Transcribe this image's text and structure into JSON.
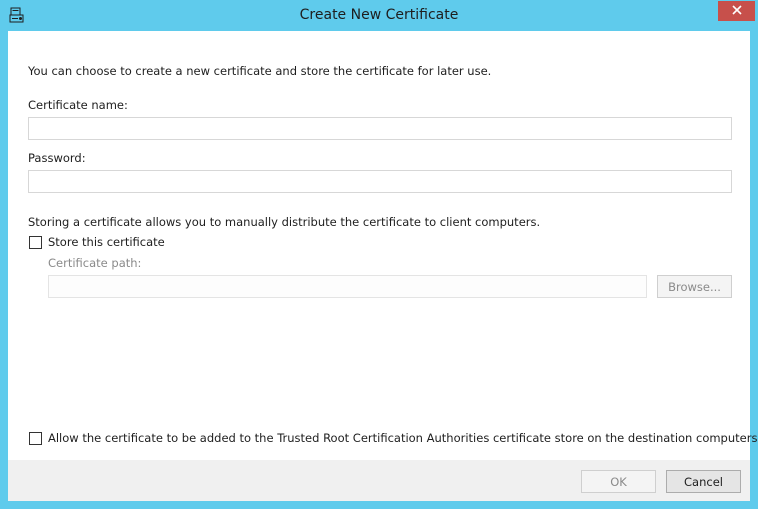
{
  "window": {
    "title": "Create New Certificate"
  },
  "dialog": {
    "intro": "You can choose to create a new certificate and store the certificate for later use.",
    "certificate_name_label": "Certificate name:",
    "certificate_name_value": "",
    "password_label": "Password:",
    "password_value": "",
    "store_info": "Storing a certificate allows you to manually distribute the certificate to client computers.",
    "store_checkbox_label": "Store this certificate",
    "store_checkbox_checked": false,
    "certificate_path_label": "Certificate path:",
    "certificate_path_value": "",
    "browse_label": "Browse...",
    "trusted_root_checkbox_label": "Allow the certificate to be added to the Trusted Root Certification Authorities certificate store on the destination computers",
    "trusted_root_checkbox_checked": false
  },
  "footer": {
    "ok_label": "OK",
    "cancel_label": "Cancel"
  },
  "icons": {
    "app": "certificate-icon",
    "close": "close-icon"
  },
  "colors": {
    "titlebar": "#5fcbec",
    "close_button": "#c7504b",
    "footer": "#f0f0f0"
  }
}
